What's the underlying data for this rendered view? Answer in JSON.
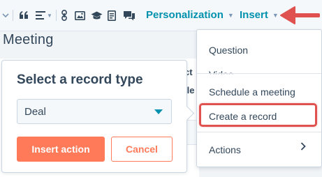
{
  "toolbar": {
    "icons": [
      "chevron-down-icon",
      "quote-icon",
      "align-icon",
      "link-icon",
      "image-icon",
      "graduation-cap-icon",
      "document-icon",
      "chat-icon"
    ],
    "personalization_label": "Personalization",
    "insert_label": "Insert"
  },
  "page": {
    "title": "Meeting",
    "fragment_1": "ct",
    "fragment_2": "ile"
  },
  "popover": {
    "title": "Select a record type",
    "select_value": "Deal",
    "insert_button": "Insert action",
    "cancel_button": "Cancel"
  },
  "menu": {
    "items": [
      {
        "label": "Question"
      },
      {
        "label": "Video"
      },
      {
        "label": "Schedule a meeting"
      },
      {
        "label": "Create a record",
        "highlighted": true
      },
      {
        "label": "Actions",
        "has_submenu": true
      }
    ]
  },
  "colors": {
    "accent_teal": "#0091ae",
    "primary_orange": "#ff7a59",
    "highlight_red": "#e0524f"
  }
}
